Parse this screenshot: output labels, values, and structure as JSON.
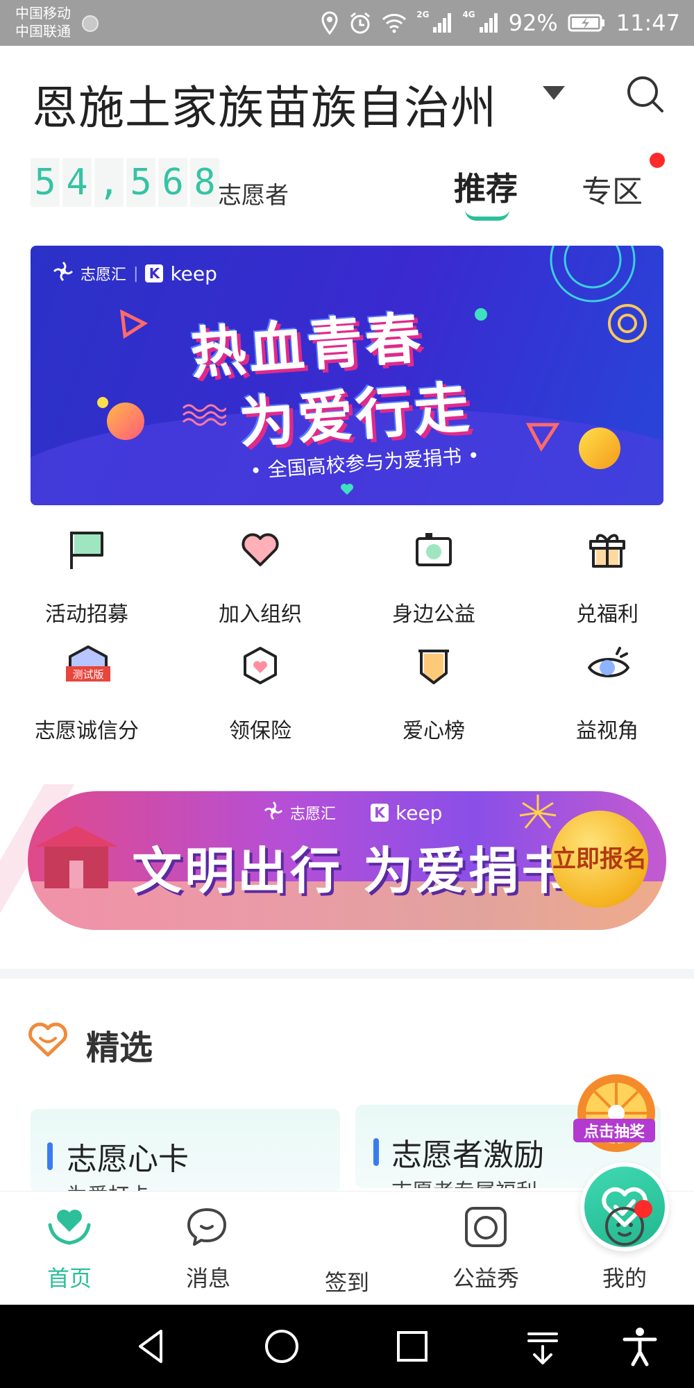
{
  "status_bar": {
    "carrier_1": "中国移动",
    "carrier_2": "中国联通",
    "net_2g": "2G",
    "net_4g": "4G",
    "battery": "92%",
    "time": "11:47"
  },
  "header": {
    "city": "恩施土家族苗族自治州"
  },
  "stats": {
    "digits": [
      "5",
      "4",
      ",",
      "5",
      "6",
      "8"
    ],
    "unit": "志愿者"
  },
  "tabs": {
    "recommend": "推荐",
    "zone": "专区"
  },
  "banner_top": {
    "brand": "志愿汇",
    "partner_mark": "K",
    "partner": "keep",
    "line1": "热血青春",
    "line2": "为爱行走",
    "subtitle": "• 全国高校参与为爱捐书 •"
  },
  "grid": {
    "items": [
      {
        "label": "活动招募",
        "icon": "flag-icon"
      },
      {
        "label": "加入组织",
        "icon": "heart-icon"
      },
      {
        "label": "身边公益",
        "icon": "camera-icon"
      },
      {
        "label": "兑福利",
        "icon": "gift-icon"
      },
      {
        "label": "志愿诚信分",
        "icon": "credit-icon",
        "badge": "测试版"
      },
      {
        "label": "领保险",
        "icon": "insurance-icon"
      },
      {
        "label": "爱心榜",
        "icon": "ranking-icon"
      },
      {
        "label": "益视角",
        "icon": "eye-icon"
      }
    ]
  },
  "banner_bottom": {
    "brand": "志愿汇",
    "partner_mark": "K",
    "partner": "keep",
    "title": "文明出行 为爱捐书",
    "cta": "立即报名"
  },
  "featured": {
    "title": "精选",
    "cards": [
      {
        "title": "志愿心卡",
        "subtitle": "为爱打卡"
      },
      {
        "title": "志愿者激励",
        "subtitle": "志愿者专属福利"
      }
    ],
    "lottery_label": "点击抽奖"
  },
  "bottom_nav": {
    "items": [
      {
        "label": "首页",
        "active": true
      },
      {
        "label": "消息",
        "active": false
      },
      {
        "label": "签到",
        "active": false
      },
      {
        "label": "公益秀",
        "active": false
      },
      {
        "label": "我的",
        "active": false
      }
    ]
  },
  "colors": {
    "accent": "#2dbf9a",
    "notification": "#ff2a2a",
    "counter_text": "#35c3a3"
  }
}
